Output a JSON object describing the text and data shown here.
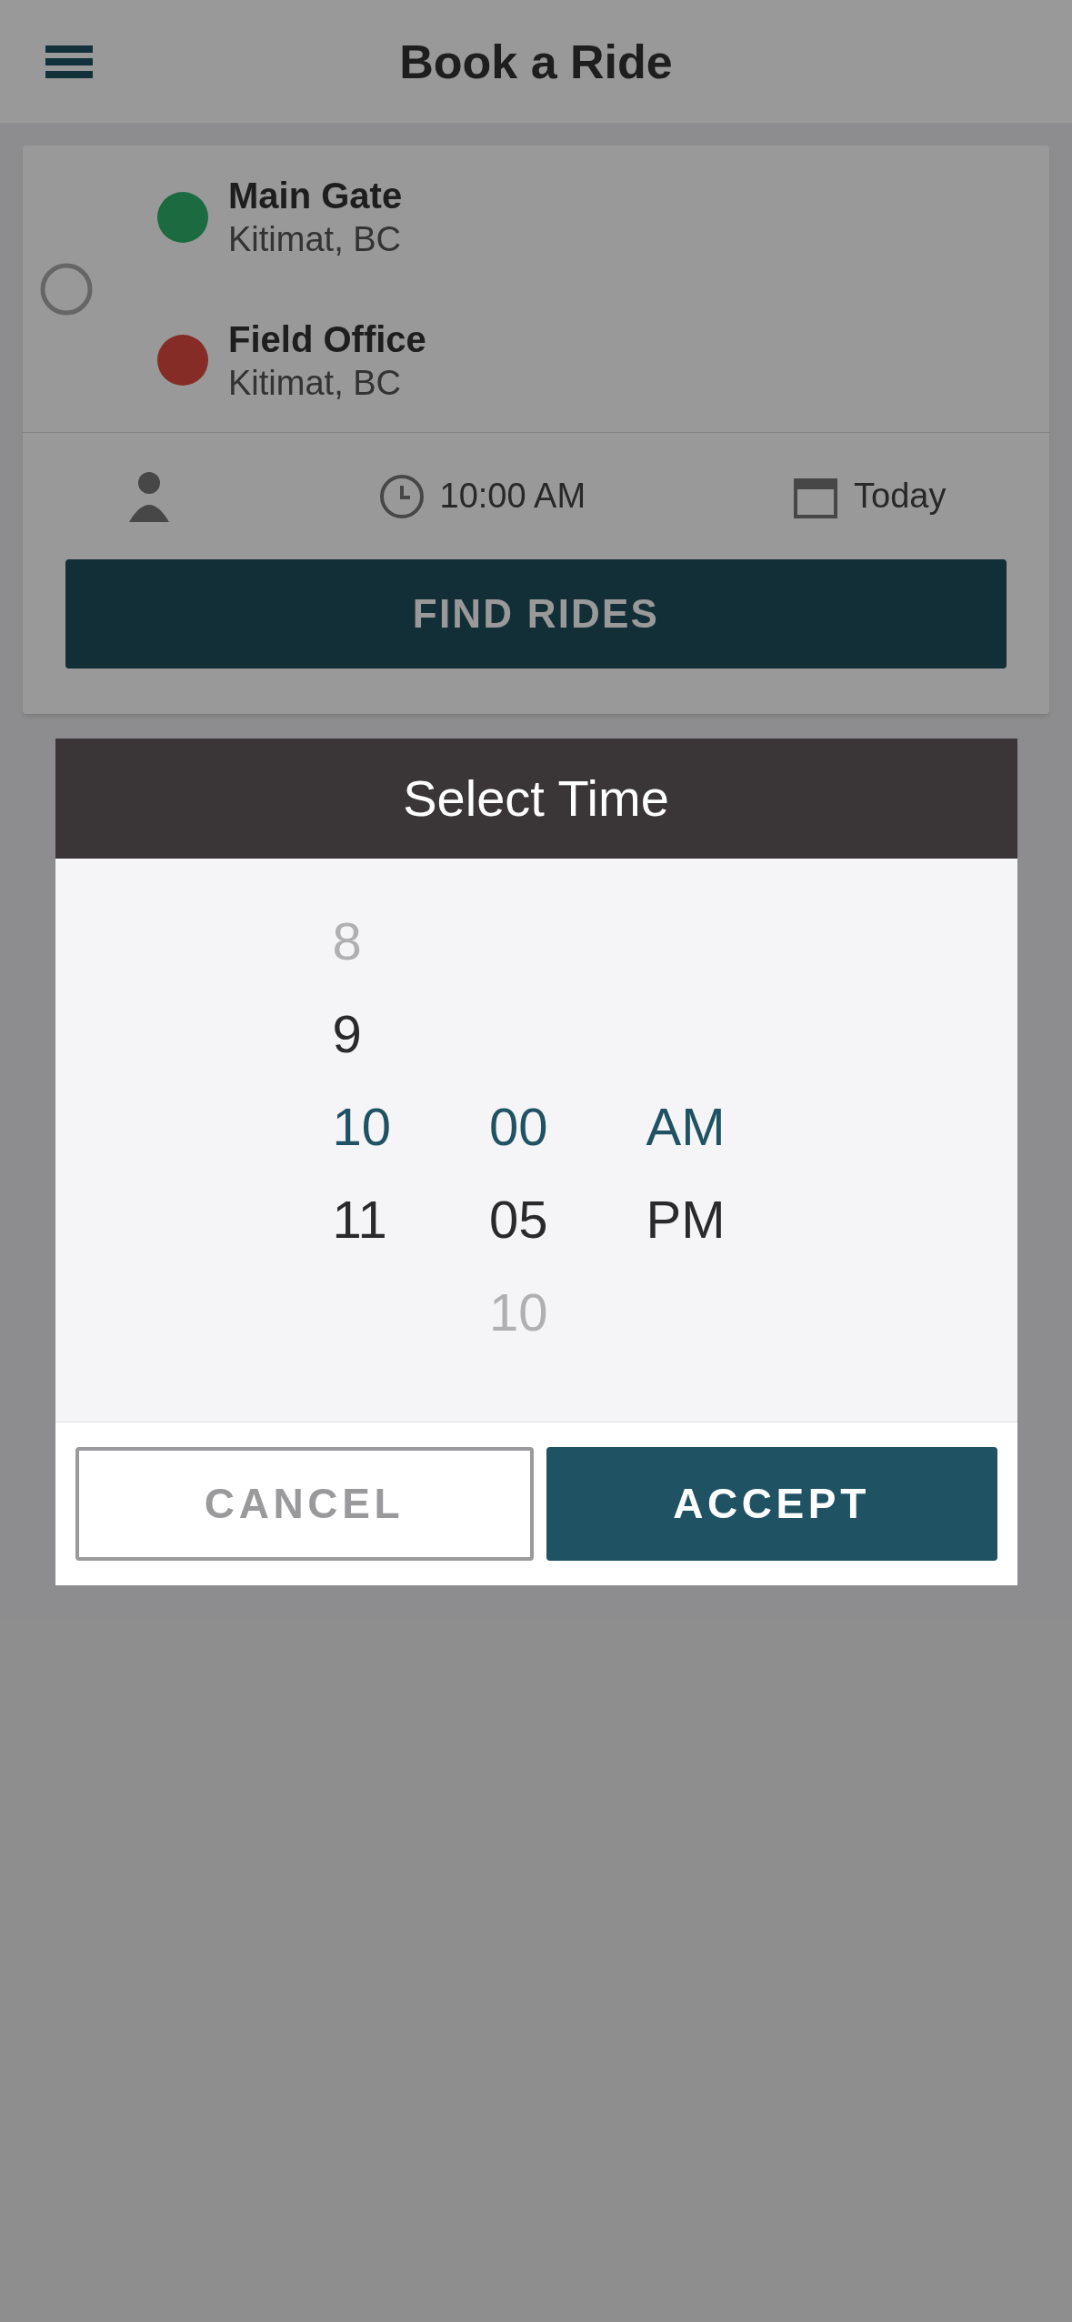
{
  "header": {
    "title": "Book a Ride"
  },
  "route": [
    {
      "kind": "origin",
      "name": "Main Gate",
      "city": "Kitimat, BC"
    },
    {
      "kind": "destination",
      "name": "Field Office",
      "city": "Kitimat, BC"
    }
  ],
  "options": {
    "time": "10:00 AM",
    "date": "Today"
  },
  "find_button": "FIND RIDES",
  "dialog": {
    "title": "Select Time",
    "columns": [
      {
        "items": [
          {
            "label": "8",
            "selected": false
          },
          {
            "label": "9",
            "selected": false
          },
          {
            "label": "10",
            "selected": true
          },
          {
            "label": "11",
            "selected": false
          }
        ]
      },
      {
        "items": [
          {
            "label": "00",
            "selected": true
          },
          {
            "label": "05",
            "selected": false
          },
          {
            "label": "10",
            "selected": false
          }
        ]
      },
      {
        "items": [
          {
            "label": "AM",
            "selected": true
          },
          {
            "label": "PM",
            "selected": false
          }
        ]
      }
    ],
    "buttons": [
      {
        "kind": "secondary",
        "label": "CANCEL"
      },
      {
        "kind": "primary",
        "label": "ACCEPT"
      }
    ]
  }
}
